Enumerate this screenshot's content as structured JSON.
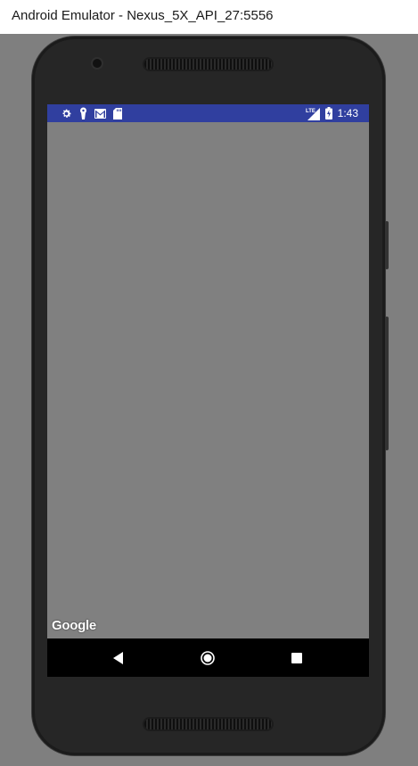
{
  "window": {
    "title": "Android Emulator - Nexus_5X_API_27:5556"
  },
  "status_bar": {
    "background": "#303f9f",
    "left_icons": [
      "gear-icon",
      "keyhole-icon",
      "gmail-icon",
      "sd-card-icon"
    ],
    "network_label": "LTE",
    "right_icons": [
      "lte-signal-icon",
      "battery-charging-icon"
    ],
    "time": "1:43"
  },
  "map": {
    "logo_text": "Google",
    "background": "#808080"
  },
  "nav_bar": {
    "icons": [
      "back-icon",
      "home-icon",
      "recents-icon"
    ]
  }
}
